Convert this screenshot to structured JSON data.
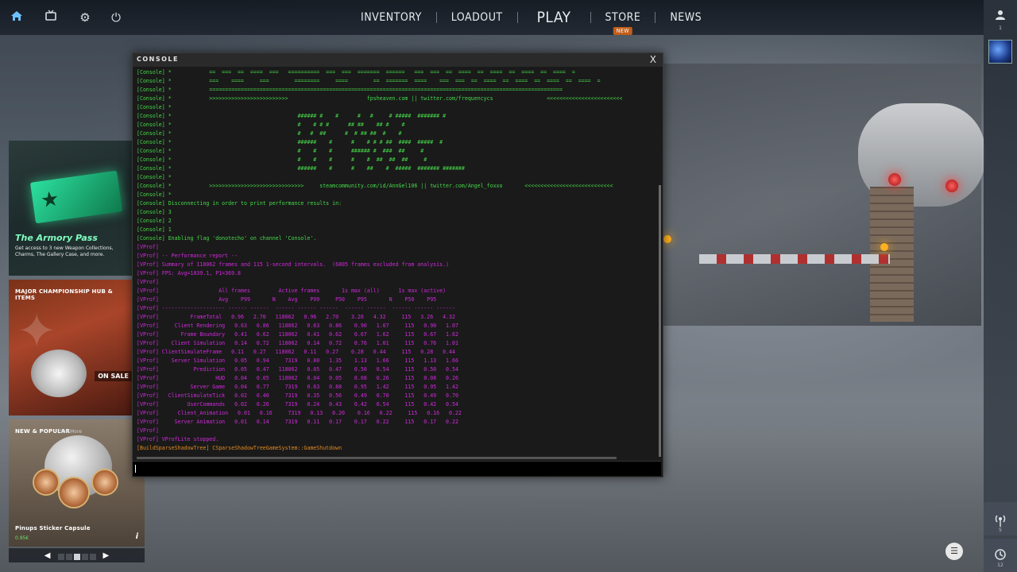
{
  "topbar": {
    "nav": [
      "INVENTORY",
      "LOADOUT",
      "PLAY",
      "STORE",
      "NEWS"
    ],
    "store_badge": "NEW",
    "icons": [
      "home-icon",
      "tv-icon",
      "gear-icon",
      "power-icon"
    ]
  },
  "rightbar": {
    "friends_count": "1",
    "signal_count": "5",
    "history_count": "12",
    "icons": [
      "user-icon",
      "broadcast-icon",
      "history-icon"
    ]
  },
  "cards": {
    "armory": {
      "title": "The Armory Pass",
      "subtitle": "Get access to 3 new Weapon Collections, Charms, The Gallery Case, and more."
    },
    "major": {
      "title": "MAJOR CHAMPIONSHIP HUB & ITEMS",
      "badge": "ON SALE"
    },
    "new_popular": {
      "title": "NEW & POPULAR",
      "tag": "See More",
      "item_name": "Pinups Sticker Capsule",
      "price": "0.95€"
    }
  },
  "console": {
    "title": "CONSOLE",
    "close": "X",
    "lines": [
      {
        "c": "green",
        "t": "[Console] *            ==  ===  ==  ====  ===   ==========  ===  ===  =======  ======   ===  ===  ==  ====  ==  ====  ==  ====  ==  ====  ="
      },
      {
        "c": "green",
        "t": "[Console] *            ===    ====     ===        ========     ====        ==  =======  ====    ===  ===  ==  ====  ==  ====  ==  ====  ==  ====  ="
      },
      {
        "c": "green",
        "t": "[Console] *            ================================================================================================================"
      },
      {
        "c": "green",
        "t": "[Console] *            >>>>>>>>>>>>>>>>>>>>>>>>>                         fpsheaven.com || twitter.com/frequencycs                 <<<<<<<<<<<<<<<<<<<<<<<<"
      },
      {
        "c": "green",
        "t": "[Console] *"
      },
      {
        "c": "green",
        "t": "[Console] *                                        ###### #    #      #   #     # #####  ####### #"
      },
      {
        "c": "green",
        "t": "[Console] *                                        #    # # #      ## ##    ## #    #"
      },
      {
        "c": "green",
        "t": "[Console] *                                        #   #  ##      #  # ## ##  #    #"
      },
      {
        "c": "green",
        "t": "[Console] *                                        ######    #      #    # # # ##  ####  #####  #"
      },
      {
        "c": "green",
        "t": "[Console] *                                        #    #    #      ###### #  ###  ##     #"
      },
      {
        "c": "green",
        "t": "[Console] *                                        #    #    #      #    #  ##  ##  ##     #"
      },
      {
        "c": "green",
        "t": "[Console] *                                        ######    #      #    ##    #  #####  ####### #######"
      },
      {
        "c": "green",
        "t": "[Console] *"
      },
      {
        "c": "green",
        "t": "[Console] *            >>>>>>>>>>>>>>>>>>>>>>>>>>>>>>     steamcommunity.com/id/AnnGel106 || twitter.com/Angel_foxxo       <<<<<<<<<<<<<<<<<<<<<<<<<<<<"
      },
      {
        "c": "green",
        "t": "[Console] *"
      },
      {
        "c": "green",
        "t": "[Console] Disconnecting in order to print performance results in:"
      },
      {
        "c": "green",
        "t": "[Console] 3"
      },
      {
        "c": "green",
        "t": "[Console] 2"
      },
      {
        "c": "green",
        "t": "[Console] 1"
      },
      {
        "c": "green",
        "t": "[Console] Enabling flag 'donotecho' on channel 'Console'."
      },
      {
        "c": "magenta",
        "t": "[VProf]"
      },
      {
        "c": "magenta",
        "t": "[VProf] -- Performance report --"
      },
      {
        "c": "magenta",
        "t": "[VProf] Summary of 118062 frames and 115 1-second intervals.  (6805 frames excluded from analysis.)"
      },
      {
        "c": "magenta",
        "t": "[VProf] FPS: Avg=1039.1, P1=369.8"
      },
      {
        "c": "magenta",
        "t": "[VProf]"
      },
      {
        "c": "magenta",
        "t": "[VProf]                   All frames         Active frames       1s max (all)      1s max (active)"
      },
      {
        "c": "magenta",
        "t": "[VProf]                   Avg    P99       N    Avg    P99     P50    P95       N    P50    P95"
      },
      {
        "c": "magenta",
        "t": "[VProf] -------------------- ------ ------  ------ ------ ------  ------ ------  ------ ------ ------"
      },
      {
        "c": "magenta",
        "t": "[VProf]          FrameTotal   0.96   2.70   118062   0.96   2.70    3.26   4.32     115   3.26   4.32"
      },
      {
        "c": "magenta",
        "t": "[VProf]     Client Rendering   0.63   0.86   118062   0.63   0.86    0.90   1.07     115   0.90   1.07"
      },
      {
        "c": "magenta",
        "t": "[VProf]       Frame Boundary   0.41   0.62   118062   0.41   0.62    0.67   1.62     115   0.67   1.62"
      },
      {
        "c": "magenta",
        "t": "[VProf]    Client Simulation   0.14   0.72   118062   0.14   0.72    0.76   1.01     115   0.76   1.01"
      },
      {
        "c": "magenta",
        "t": "[VProf] ClientSimulateFrame   0.11   0.27   118062   0.11   0.27    0.28   0.44     115   0.28   0.44"
      },
      {
        "c": "magenta",
        "t": "[VProf]    Server Simulation   0.05   0.94     7319   0.80   1.35    1.13   1.66     115   1.13   1.66"
      },
      {
        "c": "magenta",
        "t": "[VProf]           Prediction   0.05   0.47   118062   0.05   0.47    0.50   0.54     115   0.50   0.54"
      },
      {
        "c": "magenta",
        "t": "[VProf]                  HUD   0.04   0.05   118062   0.04   0.05    0.08   0.26     115   0.08   0.26"
      },
      {
        "c": "magenta",
        "t": "[VProf]          Server Game   0.04   0.77     7319   0.63   0.88    0.95   1.42     115   0.95   1.42"
      },
      {
        "c": "magenta",
        "t": "[VProf]   ClientSimulateTick   0.02   0.40     7319   0.35   0.56    0.49   0.70     115   0.49   0.70"
      },
      {
        "c": "magenta",
        "t": "[VProf]         UserCommands   0.02   0.26     7319   0.24   0.43    0.42   0.54     115   0.42   0.54"
      },
      {
        "c": "magenta",
        "t": "[VProf]      Client_Animation   0.01   0.16     7319   0.13   0.20    0.16   0.22     115   0.16   0.22"
      },
      {
        "c": "magenta",
        "t": "[VProf]     Server Animation   0.01   0.14     7319   0.11   0.17    0.17   0.22     115   0.17   0.22"
      },
      {
        "c": "magenta",
        "t": "[VProf]"
      },
      {
        "c": "magenta",
        "t": "[VProf] VProfLite stopped."
      },
      {
        "c": "orange",
        "t": "[BuildSparseShadowTree] CSparseShadowTreeGameSystem::GameShutdown"
      }
    ]
  },
  "colors": {
    "console_green": "#46d94a",
    "console_magenta": "#d02adc",
    "console_orange": "#e08a20",
    "new_badge": "#c25d1a"
  }
}
